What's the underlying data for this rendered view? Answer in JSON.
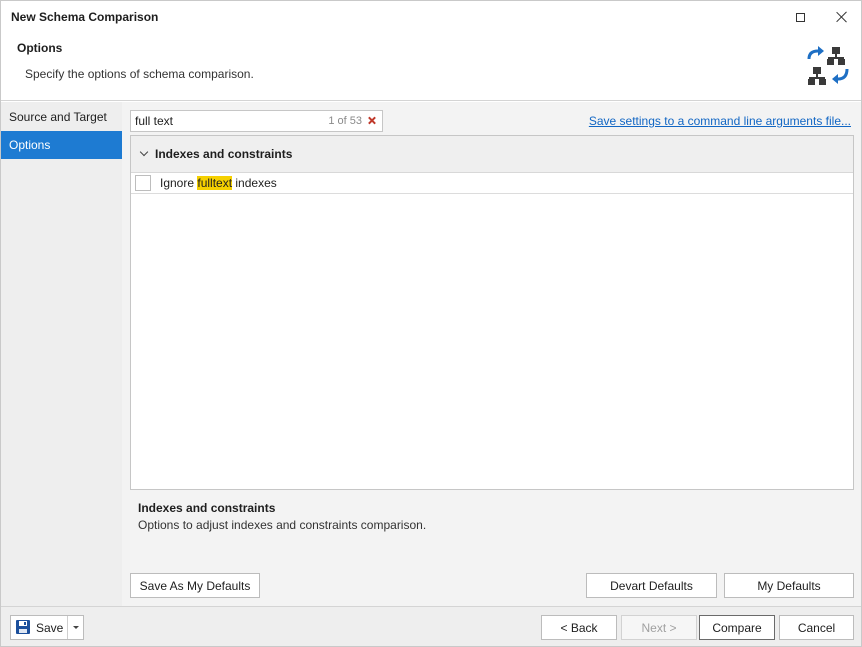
{
  "window": {
    "title": "New Schema Comparison",
    "maximize_icon": "maximize-icon",
    "close_icon": "close-icon"
  },
  "header": {
    "title": "Options",
    "description": "Specify the options of schema comparison.",
    "icon": "schema-compare-icon",
    "icon_colors": {
      "arrows": "#1e6fc4",
      "boxes": "#3a3a3a"
    }
  },
  "sidebar": {
    "items": [
      {
        "label": "Source and Target",
        "selected": false
      },
      {
        "label": "Options",
        "selected": true
      }
    ],
    "selected_color": "#1e7bd2"
  },
  "search": {
    "value": "full text",
    "match_count": "1 of 53",
    "clear_icon": "clear-icon"
  },
  "save_settings_link": "Save settings to a command line arguments file...",
  "options": {
    "group_label": "Indexes and constraints",
    "items": [
      {
        "prefix": "Ignore ",
        "highlight": "fulltext",
        "suffix": " indexes",
        "checked": false
      }
    ],
    "highlight_color": "#f5d000"
  },
  "description": {
    "title": "Indexes and constraints",
    "text": "Options to adjust indexes and constraints comparison."
  },
  "buttons": {
    "save_as_my_defaults": "Save As My Defaults",
    "devart_defaults": "Devart Defaults",
    "my_defaults": "My Defaults"
  },
  "footer": {
    "save_label": "Save",
    "save_icon": "floppy-disk-icon",
    "back": "< Back",
    "next": "Next >",
    "compare": "Compare",
    "cancel": "Cancel"
  }
}
